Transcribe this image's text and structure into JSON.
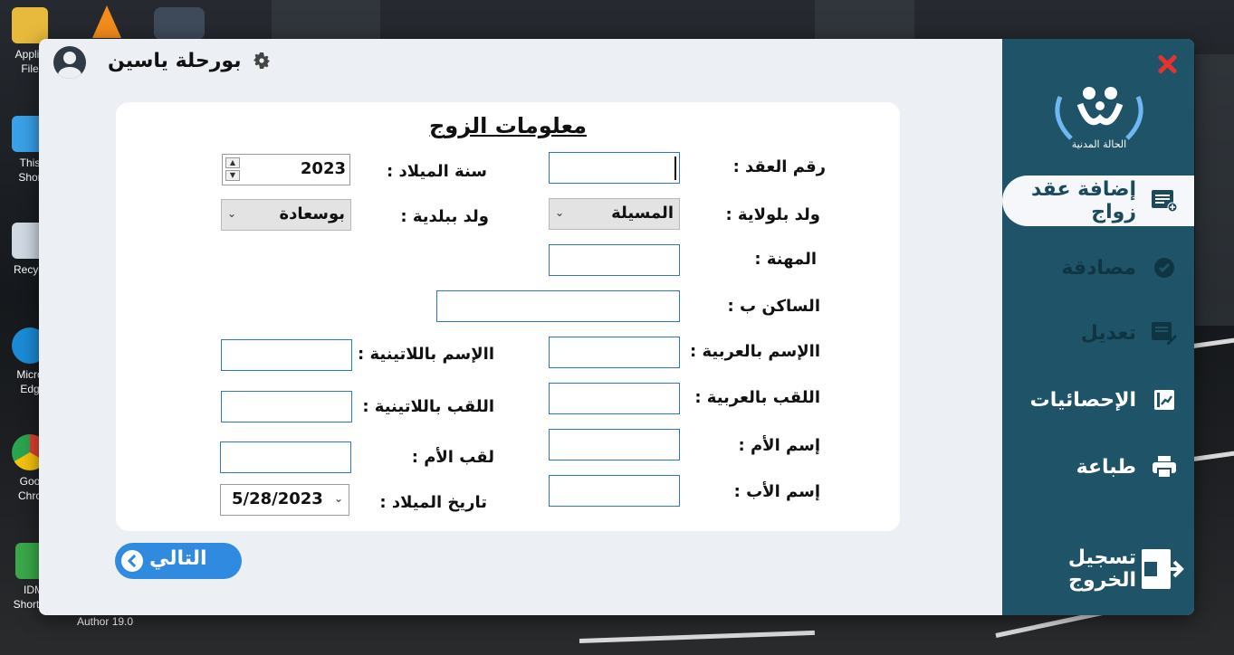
{
  "desktop": {
    "icons": [
      {
        "label": "Applic\nFile"
      },
      {
        "label": "This\nShor"
      },
      {
        "label": "Recycl"
      },
      {
        "label": "Micro\nEdg"
      },
      {
        "label": "Goo\nChro"
      },
      {
        "label": "IDM\nShortcut"
      }
    ],
    "extra_label": "Author 19.0"
  },
  "header": {
    "user_name": "بورحلة ياسين"
  },
  "sidebar": {
    "logo_text": "الحالة المدنية",
    "items": [
      {
        "label": "إضافة عقد زواج",
        "icon": "add-contract-icon",
        "active": true
      },
      {
        "label": "مصادقة",
        "icon": "verified-icon",
        "active": false
      },
      {
        "label": "تعديل",
        "icon": "edit-icon",
        "active": false
      },
      {
        "label": "الإحصائيات",
        "icon": "stats-icon",
        "active": false
      },
      {
        "label": "طباعة",
        "icon": "print-icon",
        "active": false
      }
    ],
    "logout_label": "تسجيل الخروج"
  },
  "form": {
    "title": "معلومات الزوج",
    "labels": {
      "contract_number": "رقم العقد :",
      "birth_year": "سنة الميلاد :",
      "born_in_wilaya": "ولد بلولاية :",
      "born_in_commune": "ولد ببلدية :",
      "profession": "المهنة :",
      "resident_in": "الساكن ب :",
      "first_name_ar": "االإسم بالعربية :",
      "first_name_lat": "االإسم باللاتينية :",
      "last_name_ar": "اللقب بالعربية :",
      "last_name_lat": "اللقب باللاتينية :",
      "mother_name": "إسم الأم :",
      "mother_last_name": "لقب الأم :",
      "father_name": "إسم الأب :",
      "birth_date": "تاريخ الميلاد :"
    },
    "values": {
      "birth_year": "2023",
      "wilaya": "المسيلة",
      "commune": "بوسعادة",
      "birth_date": "5/28/2023"
    },
    "next_label": "التالي"
  },
  "colors": {
    "sidebar": "#1f5468",
    "accent": "#2f8ae0",
    "close": "#e8312f"
  }
}
